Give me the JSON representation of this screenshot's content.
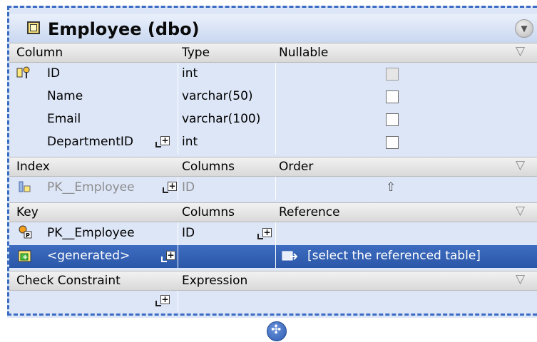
{
  "table": {
    "title": "Employee (dbo)",
    "icon": "table-icon",
    "collapse_icon": "collapse-icon"
  },
  "columns_section": {
    "headers": [
      "Column",
      "Type",
      "Nullable"
    ],
    "rows": [
      {
        "name": "ID",
        "type": "int",
        "nullable": false,
        "icon": "primary-key-icon"
      },
      {
        "name": "Name",
        "type": "varchar(50)",
        "nullable": false
      },
      {
        "name": "Email",
        "type": "varchar(100)",
        "nullable": false
      },
      {
        "name": "DepartmentID",
        "type": "int",
        "nullable": false
      }
    ]
  },
  "index_section": {
    "headers": [
      "Index",
      "Columns",
      "Order"
    ],
    "rows": [
      {
        "name": "PK__Employee",
        "columns": "ID",
        "order_icon": "⇧"
      }
    ]
  },
  "key_section": {
    "headers": [
      "Key",
      "Columns",
      "Reference"
    ],
    "rows": [
      {
        "name": "PK__Employee",
        "columns": "ID",
        "reference": ""
      },
      {
        "name": "<generated>",
        "columns": "",
        "reference": "[select the referenced table]",
        "selected": true
      }
    ]
  },
  "check_section": {
    "headers": [
      "Check Constraint",
      "Expression"
    ]
  },
  "colors": {
    "accent": "#3b6cc4",
    "selected_row": "#2f5db3",
    "panel_bg": "#dde6f7"
  }
}
